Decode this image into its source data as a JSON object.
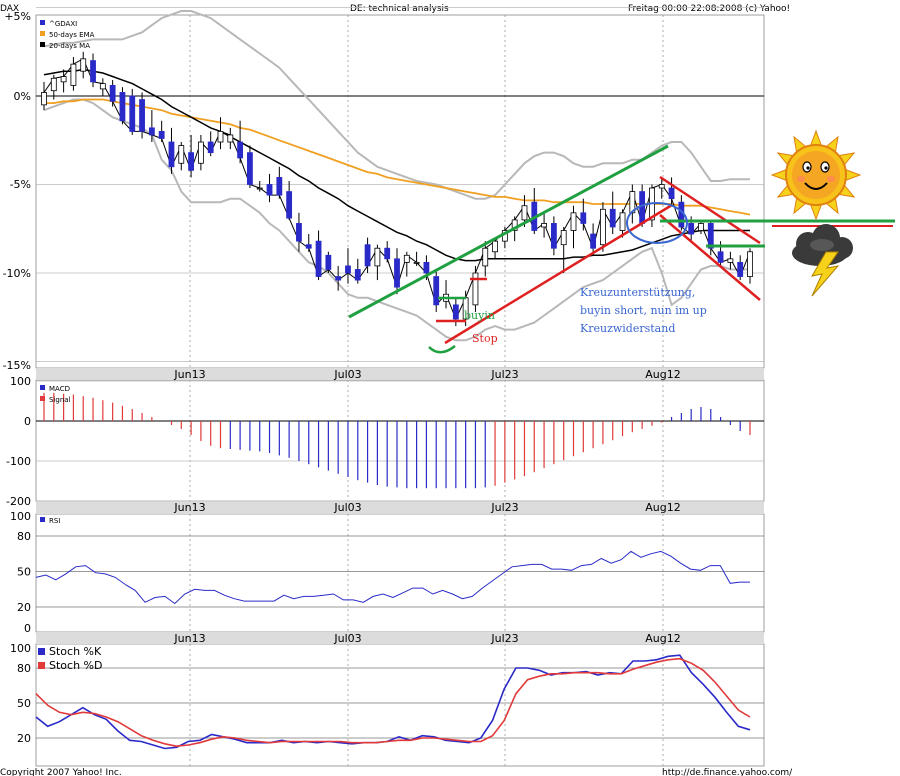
{
  "header": {
    "symbol": "DAX",
    "title": "DE: technical analysis",
    "timestamp": "Freitag 00:00 22:08:2008 (c) Yahoo!"
  },
  "footer": {
    "copyright": "Copyright 2007 Yahoo! Inc.",
    "url": "http://de.finance.yahoo.com/"
  },
  "colors": {
    "price_up": "#000000",
    "price_down": "#2a2ac8",
    "ema50": "#f0a020",
    "ma20": "#000000",
    "bollinger": "#b8b8b8",
    "macd": "#2a2ac8",
    "signal": "#e03a3a",
    "rsi": "#2a2ac8",
    "stoch_k": "#2a2ac8",
    "stoch_d": "#e03a3a",
    "trend_green": "#20a040",
    "trend_red": "#e02020",
    "annotation_blue": "#3a66d0"
  },
  "x_labels": [
    "Jun13",
    "Jul03",
    "Jul23",
    "Aug12"
  ],
  "chart_data": [
    {
      "type": "candlestick",
      "panel": "price",
      "ylabels": [
        "+5%",
        "0%",
        "-5%",
        "-10%",
        "-15%"
      ],
      "ylim": [
        -15,
        5
      ],
      "legend": [
        "^GDAXI",
        "50-days EMA",
        "20-days MA"
      ],
      "legend_position": "top-left",
      "grid": true,
      "candles": [
        {
          "o": -0.5,
          "h": 0.8,
          "l": -0.8,
          "c": 0.2
        },
        {
          "o": 0.3,
          "h": 1.2,
          "l": -0.2,
          "c": 1.0
        },
        {
          "o": 0.8,
          "h": 1.5,
          "l": 0.2,
          "c": 1.1
        },
        {
          "o": 0.6,
          "h": 2.2,
          "l": 0.3,
          "c": 1.8
        },
        {
          "o": 1.4,
          "h": 2.5,
          "l": 1.0,
          "c": 2.1
        },
        {
          "o": 2.0,
          "h": 2.4,
          "l": 0.5,
          "c": 0.8
        },
        {
          "o": 0.4,
          "h": 1.0,
          "l": 0.0,
          "c": 0.7
        },
        {
          "o": 0.6,
          "h": 0.9,
          "l": -0.6,
          "c": -0.3
        },
        {
          "o": 0.2,
          "h": 0.5,
          "l": -1.6,
          "c": -1.4
        },
        {
          "o": 0.0,
          "h": 0.4,
          "l": -2.2,
          "c": -2.0
        },
        {
          "o": -0.2,
          "h": 0.2,
          "l": -2.4,
          "c": -2.0
        },
        {
          "o": -1.8,
          "h": -0.8,
          "l": -2.6,
          "c": -2.2
        },
        {
          "o": -2.0,
          "h": -1.4,
          "l": -2.6,
          "c": -2.4
        },
        {
          "o": -2.6,
          "h": -1.8,
          "l": -4.4,
          "c": -4.0
        },
        {
          "o": -3.8,
          "h": -2.6,
          "l": -4.2,
          "c": -2.8
        },
        {
          "o": -3.2,
          "h": -2.2,
          "l": -4.6,
          "c": -4.2
        },
        {
          "o": -3.8,
          "h": -2.2,
          "l": -4.2,
          "c": -2.6
        },
        {
          "o": -2.6,
          "h": -2.0,
          "l": -3.4,
          "c": -3.2
        },
        {
          "o": -2.6,
          "h": -1.2,
          "l": -3.0,
          "c": -2.0
        },
        {
          "o": -2.6,
          "h": -1.8,
          "l": -3.0,
          "c": -2.2
        },
        {
          "o": -2.6,
          "h": -1.4,
          "l": -3.8,
          "c": -3.5
        },
        {
          "o": -3.2,
          "h": -2.8,
          "l": -5.2,
          "c": -5.0
        },
        {
          "o": -5.2,
          "h": -4.8,
          "l": -5.4,
          "c": -5.2
        },
        {
          "o": -5.0,
          "h": -4.4,
          "l": -6.0,
          "c": -5.6
        },
        {
          "o": -4.6,
          "h": -4.0,
          "l": -5.8,
          "c": -5.6
        },
        {
          "o": -5.4,
          "h": -4.8,
          "l": -7.0,
          "c": -6.9
        },
        {
          "o": -7.2,
          "h": -6.6,
          "l": -8.8,
          "c": -8.2
        },
        {
          "o": -8.4,
          "h": -7.8,
          "l": -8.8,
          "c": -8.6
        },
        {
          "o": -8.2,
          "h": -7.6,
          "l": -10.4,
          "c": -10.2
        },
        {
          "o": -9.0,
          "h": -8.8,
          "l": -10.0,
          "c": -9.8
        },
        {
          "o": -10.2,
          "h": -9.6,
          "l": -11.0,
          "c": -10.4
        },
        {
          "o": -9.6,
          "h": -8.6,
          "l": -10.6,
          "c": -10.0
        },
        {
          "o": -9.8,
          "h": -9.2,
          "l": -10.6,
          "c": -10.4
        },
        {
          "o": -8.4,
          "h": -8.0,
          "l": -10.0,
          "c": -9.6
        },
        {
          "o": -9.6,
          "h": -8.4,
          "l": -10.4,
          "c": -8.6
        },
        {
          "o": -8.6,
          "h": -8.2,
          "l": -9.4,
          "c": -9.2
        },
        {
          "o": -9.2,
          "h": -8.6,
          "l": -11.2,
          "c": -10.8
        },
        {
          "o": -9.4,
          "h": -8.8,
          "l": -10.2,
          "c": -9.0
        },
        {
          "o": -9.4,
          "h": -8.8,
          "l": -9.6,
          "c": -9.4
        },
        {
          "o": -9.4,
          "h": -9.0,
          "l": -10.4,
          "c": -10.0
        },
        {
          "o": -10.2,
          "h": -9.8,
          "l": -12.2,
          "c": -11.8
        },
        {
          "o": -11.6,
          "h": -10.4,
          "l": -12.0,
          "c": -11.2
        },
        {
          "o": -11.8,
          "h": -11.4,
          "l": -13.0,
          "c": -12.6
        },
        {
          "o": -12.6,
          "h": -11.0,
          "l": -13.0,
          "c": -11.4
        },
        {
          "o": -11.8,
          "h": -9.6,
          "l": -12.2,
          "c": -10.0
        },
        {
          "o": -9.6,
          "h": -8.2,
          "l": -10.2,
          "c": -8.6
        },
        {
          "o": -8.8,
          "h": -8.0,
          "l": -9.2,
          "c": -8.2
        },
        {
          "o": -8.2,
          "h": -7.4,
          "l": -8.6,
          "c": -7.6
        },
        {
          "o": -7.6,
          "h": -6.8,
          "l": -8.2,
          "c": -7.0
        },
        {
          "o": -7.0,
          "h": -5.6,
          "l": -7.4,
          "c": -6.2
        },
        {
          "o": -6.0,
          "h": -5.2,
          "l": -7.8,
          "c": -7.6
        },
        {
          "o": -7.4,
          "h": -6.6,
          "l": -8.0,
          "c": -7.2
        },
        {
          "o": -7.2,
          "h": -6.8,
          "l": -9.0,
          "c": -8.6
        },
        {
          "o": -8.4,
          "h": -7.4,
          "l": -10.0,
          "c": -7.6
        },
        {
          "o": -7.6,
          "h": -6.2,
          "l": -8.6,
          "c": -6.6
        },
        {
          "o": -6.6,
          "h": -5.8,
          "l": -7.6,
          "c": -7.2
        },
        {
          "o": -7.8,
          "h": -7.2,
          "l": -9.0,
          "c": -8.6
        },
        {
          "o": -8.4,
          "h": -6.0,
          "l": -8.8,
          "c": -6.4
        },
        {
          "o": -6.4,
          "h": -5.4,
          "l": -7.8,
          "c": -7.4
        },
        {
          "o": -7.6,
          "h": -6.4,
          "l": -8.0,
          "c": -6.6
        },
        {
          "o": -6.6,
          "h": -5.0,
          "l": -7.2,
          "c": -5.4
        },
        {
          "o": -5.4,
          "h": -5.0,
          "l": -7.4,
          "c": -7.2
        },
        {
          "o": -7.0,
          "h": -5.0,
          "l": -7.4,
          "c": -5.2
        },
        {
          "o": -5.2,
          "h": -4.6,
          "l": -5.8,
          "c": -5.0
        },
        {
          "o": -5.2,
          "h": -4.6,
          "l": -6.2,
          "c": -5.8
        },
        {
          "o": -6.0,
          "h": -5.6,
          "l": -7.6,
          "c": -7.4
        },
        {
          "o": -7.2,
          "h": -6.8,
          "l": -8.2,
          "c": -7.8
        },
        {
          "o": -7.6,
          "h": -7.0,
          "l": -7.8,
          "c": -7.2
        },
        {
          "o": -7.2,
          "h": -7.0,
          "l": -9.0,
          "c": -8.6
        },
        {
          "o": -8.8,
          "h": -8.2,
          "l": -9.6,
          "c": -9.4
        },
        {
          "o": -9.4,
          "h": -8.8,
          "l": -9.8,
          "c": -9.2
        },
        {
          "o": -9.4,
          "h": -9.0,
          "l": -10.4,
          "c": -10.2
        },
        {
          "o": -10.2,
          "h": -8.6,
          "l": -10.6,
          "c": -8.8
        }
      ],
      "ema50": [
        -0.4,
        -0.4,
        -0.3,
        -0.3,
        -0.2,
        -0.2,
        -0.2,
        -0.3,
        -0.4,
        -0.5,
        -0.6,
        -0.7,
        -0.8,
        -1.0,
        -1.1,
        -1.2,
        -1.3,
        -1.4,
        -1.5,
        -1.6,
        -1.8,
        -1.9,
        -2.1,
        -2.3,
        -2.5,
        -2.7,
        -2.9,
        -3.1,
        -3.3,
        -3.5,
        -3.7,
        -3.9,
        -4.1,
        -4.3,
        -4.4,
        -4.6,
        -4.7,
        -4.8,
        -4.9,
        -5.0,
        -5.1,
        -5.2,
        -5.3,
        -5.4,
        -5.5,
        -5.6,
        -5.7,
        -5.7,
        -5.8,
        -5.9,
        -5.9,
        -5.9,
        -6.0,
        -6.0,
        -6.0,
        -6.0,
        -6.1,
        -6.1,
        -6.1,
        -6.1,
        -6.1,
        -6.1,
        -6.1,
        -6.1,
        -6.1,
        -6.2,
        -6.2,
        -6.2,
        -6.3,
        -6.4,
        -6.5,
        -6.6,
        -6.7
      ],
      "ma20": [
        1.2,
        1.3,
        1.4,
        1.4,
        1.5,
        1.4,
        1.3,
        1.1,
        0.9,
        0.7,
        0.4,
        0.1,
        -0.2,
        -0.6,
        -0.9,
        -1.2,
        -1.5,
        -1.8,
        -2.0,
        -2.3,
        -2.6,
        -2.9,
        -3.2,
        -3.5,
        -3.8,
        -4.1,
        -4.5,
        -4.8,
        -5.2,
        -5.5,
        -5.8,
        -6.2,
        -6.5,
        -6.8,
        -7.1,
        -7.4,
        -7.7,
        -7.9,
        -8.2,
        -8.4,
        -8.7,
        -9.0,
        -9.2,
        -9.3,
        -9.3,
        -9.2,
        -9.2,
        -9.2,
        -9.2,
        -9.2,
        -9.2,
        -9.2,
        -9.2,
        -9.2,
        -9.1,
        -9.1,
        -9.0,
        -9.0,
        -8.9,
        -8.8,
        -8.7,
        -8.5,
        -8.3,
        -8.1,
        -7.9,
        -7.8,
        -7.7,
        -7.6,
        -7.6,
        -7.6,
        -7.6,
        -7.6,
        -7.6
      ],
      "bb_upper": [
        2.8,
        2.9,
        3.0,
        3.0,
        3.1,
        3.2,
        3.2,
        3.2,
        3.2,
        3.4,
        3.6,
        4.0,
        4.4,
        4.6,
        4.8,
        4.8,
        4.6,
        4.4,
        4.0,
        3.6,
        3.2,
        2.8,
        2.4,
        2.0,
        1.6,
        1.0,
        0.4,
        -0.2,
        -0.8,
        -1.4,
        -2.0,
        -2.6,
        -3.2,
        -3.6,
        -4.0,
        -4.2,
        -4.4,
        -4.6,
        -4.8,
        -4.9,
        -5.0,
        -5.2,
        -5.4,
        -5.6,
        -5.8,
        -5.8,
        -5.6,
        -5.0,
        -4.4,
        -3.8,
        -3.4,
        -3.2,
        -3.2,
        -3.4,
        -3.8,
        -4.0,
        -4.0,
        -3.8,
        -3.8,
        -3.8,
        -3.6,
        -3.6,
        -3.2,
        -2.8,
        -2.6,
        -2.6,
        -3.2,
        -4.0,
        -4.8,
        -4.8,
        -4.7,
        -4.7,
        -4.7
      ],
      "bb_lower": [
        -0.8,
        -0.6,
        -0.4,
        -0.2,
        -0.2,
        -0.4,
        -0.8,
        -1.2,
        -1.4,
        -1.6,
        -1.8,
        -2.2,
        -3.6,
        -4.2,
        -5.4,
        -6.0,
        -6.0,
        -6.0,
        -6.0,
        -5.8,
        -5.8,
        -6.2,
        -6.6,
        -7.2,
        -7.6,
        -8.2,
        -8.8,
        -9.4,
        -9.6,
        -10.0,
        -10.6,
        -11.2,
        -11.4,
        -11.4,
        -11.6,
        -11.8,
        -12.0,
        -12.2,
        -12.4,
        -12.8,
        -13.2,
        -13.6,
        -13.8,
        -13.8,
        -13.6,
        -13.2,
        -13.0,
        -13.2,
        -13.2,
        -13.0,
        -12.8,
        -12.4,
        -12.0,
        -11.6,
        -11.2,
        -10.8,
        -10.6,
        -10.4,
        -10.0,
        -9.6,
        -9.2,
        -8.8,
        -8.6,
        -10.0,
        -11.8,
        -11.4,
        -10.6,
        -9.8,
        -9.6,
        -9.6,
        -9.8,
        -9.8,
        -9.8
      ]
    },
    {
      "type": "bar",
      "panel": "macd",
      "yticks": [
        100,
        0,
        -100,
        -200
      ],
      "ylim": [
        -210,
        110
      ],
      "legend": [
        "MACD",
        "Signal"
      ],
      "legend_position": "top-left",
      "values": [
        70,
        70,
        68,
        66,
        62,
        58,
        52,
        46,
        38,
        30,
        20,
        10,
        0,
        -10,
        -20,
        -35,
        -50,
        -62,
        -68,
        -70,
        -72,
        -74,
        -76,
        -80,
        -86,
        -92,
        -100,
        -108,
        -116,
        -124,
        -132,
        -140,
        -148,
        -154,
        -160,
        -164,
        -166,
        -168,
        -168,
        -168,
        -168,
        -168,
        -168,
        -168,
        -168,
        -166,
        -162,
        -154,
        -146,
        -138,
        -128,
        -118,
        -108,
        -98,
        -88,
        -78,
        -68,
        -58,
        -48,
        -38,
        -28,
        -20,
        -12,
        -4,
        10,
        20,
        30,
        35,
        30,
        10,
        -10,
        -25,
        -35
      ],
      "signal_values": [
        72,
        72,
        70,
        68,
        64,
        60,
        54,
        48,
        40,
        32,
        22,
        12,
        2,
        -8,
        -18,
        -32,
        -46,
        -58,
        -66,
        -70,
        -72,
        -74,
        -78,
        -82,
        -88,
        -94,
        -102,
        -110,
        -118,
        -126,
        -134,
        -142,
        -150,
        -156,
        -162,
        -166,
        -168,
        -170,
        -170,
        -170,
        -170,
        -170,
        -170,
        -170,
        -168,
        -166,
        -160,
        -150,
        -140,
        -130,
        -120,
        -110,
        -100,
        -90,
        -80,
        -70,
        -60,
        -50,
        -40,
        -30,
        -22,
        -14,
        -6,
        0,
        6,
        10,
        8,
        2,
        -6,
        -14,
        -20,
        -26,
        -30
      ]
    },
    {
      "type": "line",
      "panel": "rsi",
      "yticks": [
        100,
        80,
        50,
        20,
        0
      ],
      "ylim": [
        0,
        100
      ],
      "legend": [
        "RSI"
      ],
      "legend_position": "top-left",
      "values": [
        45,
        47,
        43,
        48,
        54,
        55,
        49,
        48,
        45,
        39,
        34,
        24,
        28,
        29,
        23,
        31,
        35,
        34,
        34,
        30,
        27,
        25,
        25,
        25,
        25,
        30,
        27,
        29,
        29,
        30,
        31,
        26,
        26,
        24,
        29,
        31,
        28,
        32,
        36,
        36,
        31,
        34,
        31,
        27,
        29,
        36,
        42,
        48,
        54,
        55,
        56,
        56,
        52,
        52,
        51,
        55,
        56,
        61,
        57,
        60,
        67,
        62,
        65,
        67,
        63,
        57,
        52,
        51,
        55,
        55,
        40,
        41,
        41
      ]
    },
    {
      "type": "line",
      "panel": "stochastic",
      "yticks": [
        100,
        80,
        50,
        20
      ],
      "ylim": [
        5,
        105
      ],
      "legend": [
        "Stoch %K",
        "Stoch %D"
      ],
      "legend_position": "top-left",
      "series": [
        {
          "name": "Stoch %K",
          "values": [
            38,
            30,
            34,
            40,
            46,
            40,
            36,
            26,
            18,
            17,
            14,
            11,
            12,
            17,
            18,
            23,
            21,
            19,
            16,
            16,
            16,
            18,
            16,
            17,
            16,
            17,
            16,
            15,
            16,
            16,
            17,
            21,
            18,
            22,
            21,
            18,
            17,
            16,
            20,
            35,
            62,
            80,
            80,
            78,
            74,
            76,
            76,
            77,
            74,
            76,
            75,
            86,
            86,
            87,
            90,
            91,
            76,
            66,
            55,
            42,
            30,
            27
          ]
        },
        {
          "name": "Stoch %D",
          "values": [
            58,
            48,
            42,
            40,
            42,
            41,
            38,
            34,
            28,
            22,
            18,
            15,
            13,
            14,
            16,
            19,
            21,
            20,
            18,
            17,
            16,
            17,
            17,
            17,
            17,
            17,
            17,
            16,
            16,
            16,
            17,
            18,
            18,
            20,
            20,
            19,
            18,
            17,
            17,
            22,
            35,
            58,
            70,
            73,
            75,
            75,
            76,
            76,
            76,
            75,
            75,
            79,
            82,
            85,
            87,
            88,
            84,
            78,
            68,
            56,
            44,
            38
          ]
        }
      ]
    }
  ],
  "annotations": {
    "comment_line1": "Kreuzunterstützung,",
    "comment_line2": "buyin short, nun im up",
    "comment_line3": "Kreuzwiderstand",
    "buyin": "buyin",
    "stop": "Stop"
  }
}
